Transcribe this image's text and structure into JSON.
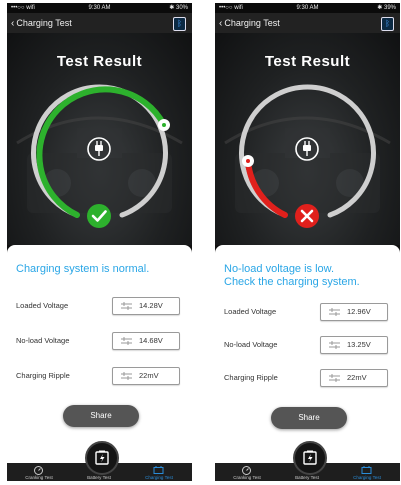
{
  "screens": [
    {
      "status": {
        "carrier": "•••○○ wifi",
        "time": "9:30 AM",
        "battery": "✱ 30%"
      },
      "nav": {
        "back_label": "Charging Test",
        "bluetooth_icon": "bluetooth-icon"
      },
      "title": "Test Result",
      "result": {
        "state": "pass",
        "icon": "check-icon",
        "color": "#2db12d",
        "gauge_level": 0.82
      },
      "message": "Charging system is normal.",
      "rows": [
        {
          "label": "Loaded Voltage",
          "value": "14.28V"
        },
        {
          "label": "No-load Voltage",
          "value": "14.68V"
        },
        {
          "label": "Charging Ripple",
          "value": "22mV"
        }
      ],
      "share_label": "Share",
      "tabs": [
        {
          "label": "Cranking Test",
          "icon": "speedometer-icon"
        },
        {
          "label": "Battery Test",
          "icon": "battery-icon"
        },
        {
          "label": "Charging Test",
          "icon": "car-battery-icon"
        }
      ],
      "active_tab": 2
    },
    {
      "status": {
        "carrier": "•••○○ wifi",
        "time": "9:30 AM",
        "battery": "✱ 39%"
      },
      "nav": {
        "back_label": "Charging Test",
        "bluetooth_icon": "bluetooth-icon"
      },
      "title": "Test Result",
      "result": {
        "state": "fail",
        "icon": "cross-icon",
        "color": "#e0201c",
        "gauge_level": 0.2
      },
      "message": "No-load voltage is low.\nCheck the charging system.",
      "rows": [
        {
          "label": "Loaded Voltage",
          "value": "12.96V"
        },
        {
          "label": "No-load Voltage",
          "value": "13.25V"
        },
        {
          "label": "Charging Ripple",
          "value": "22mV"
        }
      ],
      "share_label": "Share",
      "tabs": [
        {
          "label": "Cranking Test",
          "icon": "speedometer-icon"
        },
        {
          "label": "Battery Test",
          "icon": "battery-icon"
        },
        {
          "label": "Charging Test",
          "icon": "car-battery-icon"
        }
      ],
      "active_tab": 2
    }
  ]
}
